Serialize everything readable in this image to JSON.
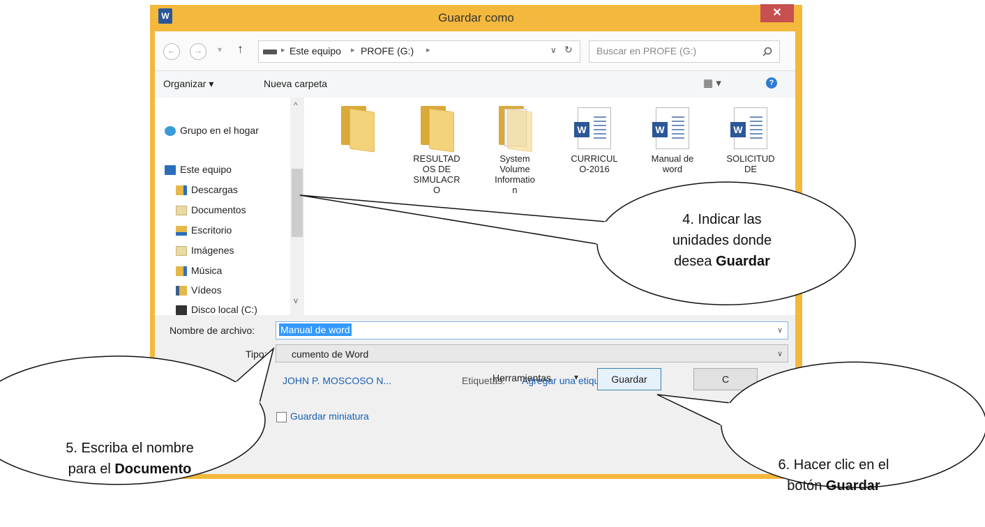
{
  "window": {
    "title": "Guardar como",
    "app_icon_label": "W",
    "close_glyph": "✕",
    "frame_color": "#f4b83d"
  },
  "navbar": {
    "back_glyph": "←",
    "forward_glyph": "→",
    "history_glyph": "▾",
    "up_glyph": "↑",
    "breadcrumb": [
      "Este equipo",
      "PROFE (G:)"
    ],
    "separator": "▸",
    "refresh_glyph": "↻",
    "dropdown_glyph": "∨",
    "search_placeholder": "Buscar en PROFE (G:)",
    "search_icon": "search-icon"
  },
  "toolbar": {
    "organize": "Organizar ▾",
    "new_folder": "Nueva carpeta",
    "view_glyph": "▦ ▾",
    "help_glyph": "?"
  },
  "nav_pane": {
    "scroll_up": "^",
    "scroll_down": "v",
    "homegroup": "Grupo en el hogar",
    "this_pc": "Este equipo",
    "items": [
      "Descargas",
      "Documentos",
      "Escritorio",
      "Imágenes",
      "Música",
      "Vídeos",
      "Disco local (C:)"
    ]
  },
  "files": [
    {
      "type": "folder",
      "name_lines": []
    },
    {
      "type": "folder",
      "name_lines": [
        "RESULTAD",
        "OS DE",
        "SIMULACR",
        "O"
      ]
    },
    {
      "type": "folder-system",
      "name_lines": [
        "System",
        "Volume",
        "Informatio",
        "n"
      ]
    },
    {
      "type": "word",
      "name_lines": [
        "CURRICUL",
        "O-2016"
      ]
    },
    {
      "type": "word",
      "name_lines": [
        "Manual de",
        "word"
      ]
    },
    {
      "type": "word",
      "name_lines": [
        "SOLICITUD",
        "DE"
      ]
    }
  ],
  "form": {
    "filename_label": "Nombre de archivo:",
    "filename_value": "Manual de word",
    "type_label": "Tipo:",
    "type_value": "cumento de Word",
    "author_value": "JOHN P. MOSCOSO N...",
    "tags_label": "Etiquetas:",
    "tags_link": "Agregar una etiqueta",
    "thumbnail_label": "Guardar miniatura",
    "tools_label": "Herramientas",
    "tools_arrow": "▾",
    "save_button": "Guardar",
    "cancel_button": "C",
    "combo_arrow": "∨"
  },
  "callouts": {
    "c4": {
      "line1": "4.  Indicar las",
      "line2": "unidades donde",
      "line3_prefix": "desea ",
      "line3_bold": "Guardar"
    },
    "c5": {
      "line1": "5.  Escriba el nombre",
      "line2_prefix": "para el ",
      "line2_bold": "Documento"
    },
    "c6": {
      "line1": "6.  Hacer clic en el",
      "line2_prefix": "botón ",
      "line2_bold": "Guardar"
    }
  }
}
